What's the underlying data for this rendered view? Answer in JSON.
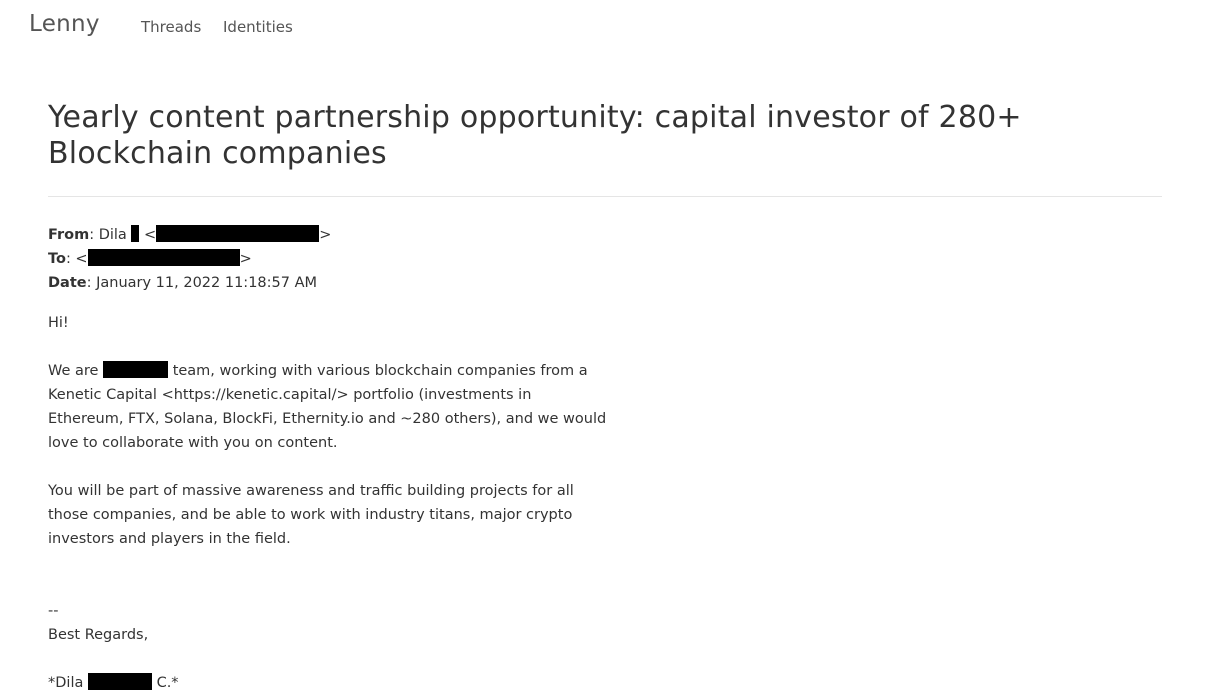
{
  "nav": {
    "brand": "Lenny",
    "links": [
      "Threads",
      "Identities"
    ]
  },
  "message": {
    "title": "Yearly content partnership opportunity: capital investor of 280+ Blockchain companies",
    "from_label": "From",
    "from_name": "Dila",
    "to_label": "To",
    "date_label": "Date",
    "date_value": "January 11, 2022 11:18:57 AM",
    "greeting": "Hi!",
    "p1_before": "We are",
    "p1_after": "team, working with various blockchain companies from a Kenetic Capital <https://kenetic.capital/> portfolio (investments in Ethereum, FTX, Solana, BlockFi, Ethernity.io and ~280 others), and we would love to collaborate with you on content.",
    "p2": "You will be part of massive awareness and traffic building projects for all those companies, and be able to work with industry titans, major crypto investors and players in the field.",
    "sig_dash": "--",
    "sig_regards": "Best Regards,",
    "sig_first": "*Dila",
    "sig_last": "C.*"
  },
  "colors": {
    "text": "#333333",
    "nav_text": "#555555",
    "redaction": "#000000",
    "divider": "#e5e5e5"
  }
}
